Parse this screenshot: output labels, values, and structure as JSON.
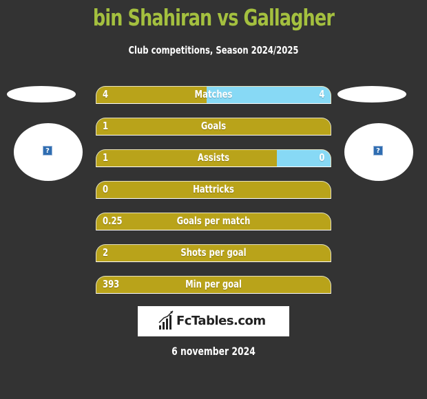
{
  "header": {
    "title": "bin Shahiran vs Gallagher",
    "subtitle": "Club competitions, Season 2024/2025"
  },
  "colors": {
    "background": "#333333",
    "title": "#a4c03f",
    "left_bar": "#b9a31a",
    "right_bar": "#87d9f5"
  },
  "players": {
    "left": {
      "name": "bin Shahiran",
      "image_icon": "broken-image-icon"
    },
    "right": {
      "name": "Gallagher",
      "image_icon": "broken-image-icon"
    }
  },
  "stats": [
    {
      "label": "Matches",
      "left": "4",
      "right": "4",
      "left_fraction": 0.47
    },
    {
      "label": "Goals",
      "left": "1",
      "right": "",
      "left_fraction": 1.0
    },
    {
      "label": "Assists",
      "left": "1",
      "right": "0",
      "left_fraction": 0.77
    },
    {
      "label": "Hattricks",
      "left": "0",
      "right": "",
      "left_fraction": 1.0
    },
    {
      "label": "Goals per match",
      "left": "0.25",
      "right": "",
      "left_fraction": 1.0
    },
    {
      "label": "Shots per goal",
      "left": "2",
      "right": "",
      "left_fraction": 1.0
    },
    {
      "label": "Min per goal",
      "left": "393",
      "right": "",
      "left_fraction": 1.0
    }
  ],
  "footer": {
    "logo_text": "FcTables.com",
    "logo_icon": "bar-chart-icon",
    "date": "6 november 2024"
  }
}
